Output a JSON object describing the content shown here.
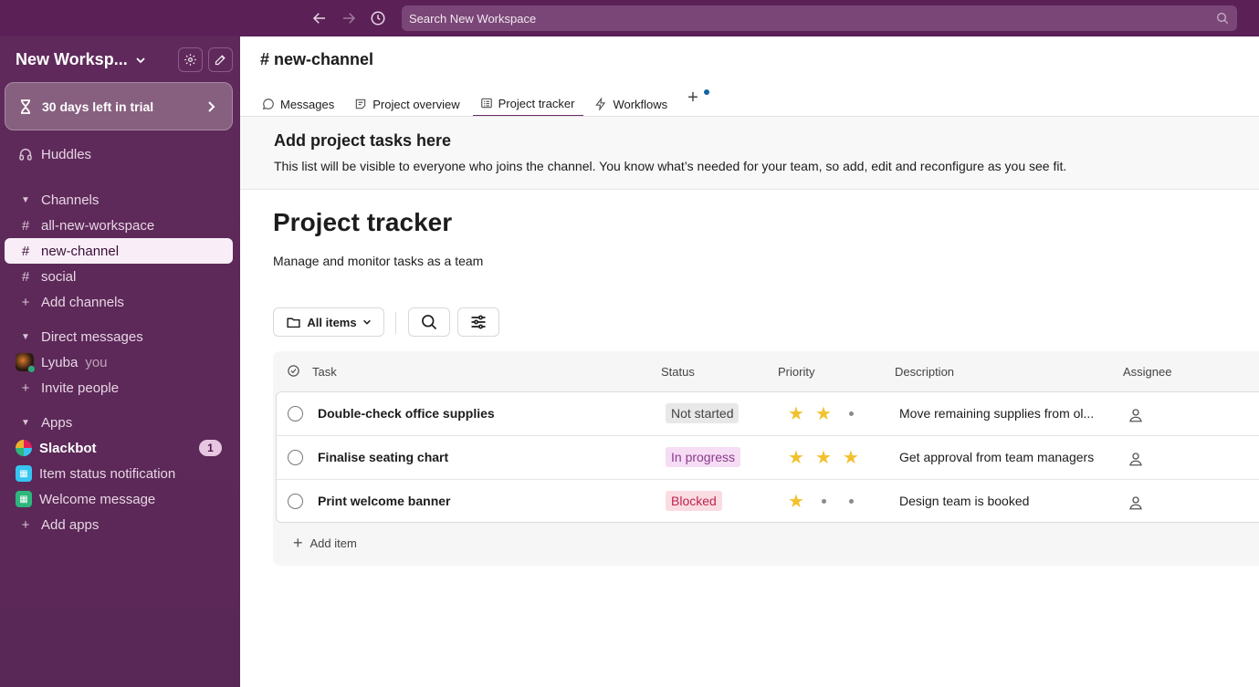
{
  "topbar": {
    "search_placeholder": "Search New Workspace"
  },
  "sidebar": {
    "workspace_name": "New Worksp...",
    "trial_label": "30 days left in trial",
    "huddles_label": "Huddles",
    "channels_section": "Channels",
    "channels": [
      {
        "name": "all-new-workspace",
        "active": false
      },
      {
        "name": "new-channel",
        "active": true
      },
      {
        "name": "social",
        "active": false
      }
    ],
    "add_channels_label": "Add channels",
    "dm_section": "Direct messages",
    "dm_user": "Lyuba",
    "dm_you": "you",
    "invite_label": "Invite people",
    "apps_section": "Apps",
    "apps": [
      {
        "name": "Slackbot",
        "badge": "1"
      },
      {
        "name": "Item status notification"
      },
      {
        "name": "Welcome message"
      }
    ],
    "add_apps_label": "Add apps"
  },
  "main": {
    "channel_title": "# new-channel",
    "tabs": [
      {
        "label": "Messages",
        "icon": "message-icon"
      },
      {
        "label": "Project overview",
        "icon": "canvas-icon"
      },
      {
        "label": "Project tracker",
        "icon": "list-icon",
        "active": true
      },
      {
        "label": "Workflows",
        "icon": "lightning-icon"
      }
    ],
    "banner": {
      "title": "Add project tasks here",
      "text": "This list will be visible to everyone who joins the channel. You know what’s needed for your team, so add, edit and reconfigure as you see fit."
    },
    "tracker_title": "Project tracker",
    "tracker_subtitle": "Manage and monitor tasks as a team",
    "filter_label": "All items",
    "columns": {
      "task": "Task",
      "status": "Status",
      "priority": "Priority",
      "description": "Description",
      "assignee": "Assignee"
    },
    "rows": [
      {
        "task": "Double-check office supplies",
        "status": "Not started",
        "status_bg": "#e8e8e8",
        "status_color": "#454245",
        "priority": 2,
        "description": "Move remaining supplies from ol..."
      },
      {
        "task": "Finalise seating chart",
        "status": "In progress",
        "status_bg": "#f6dcf5",
        "status_color": "#8a3b8b",
        "priority": 3,
        "description": "Get approval from team managers"
      },
      {
        "task": "Print welcome banner",
        "status": "Blocked",
        "status_bg": "#fbdce3",
        "status_color": "#c0234c",
        "priority": 1,
        "description": "Design team is booked"
      }
    ],
    "add_item_label": "Add item"
  }
}
